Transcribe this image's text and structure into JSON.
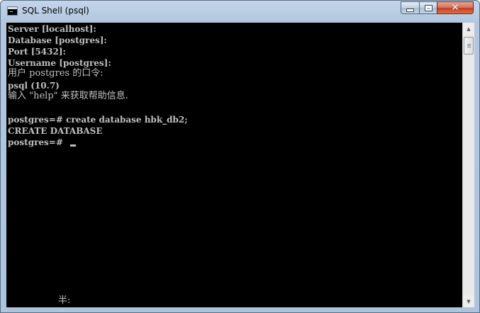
{
  "window": {
    "title": "SQL Shell (psql)",
    "icon": "console-icon"
  },
  "controls": {
    "minimize_icon": "minimize-icon",
    "maximize_icon": "maximize-icon",
    "close_icon": "close-icon",
    "close_glyph": "✕"
  },
  "console": {
    "lines": [
      "Server [localhost]:",
      "Database [postgres]:",
      "Port [5432]:",
      "Username [postgres]:",
      "用户 postgres 的口令:",
      "psql (10.7)",
      "输入 \"help\" 来获取帮助信息.",
      "",
      "postgres=# create database hbk_db2;",
      "CREATE DATABASE",
      "postgres=# "
    ],
    "ime_status": "半:",
    "colors": {
      "background": "#000000",
      "text": "#c0c0c0"
    }
  },
  "scrollbar": {
    "up_arrow": "▲",
    "down_arrow": "▼"
  }
}
